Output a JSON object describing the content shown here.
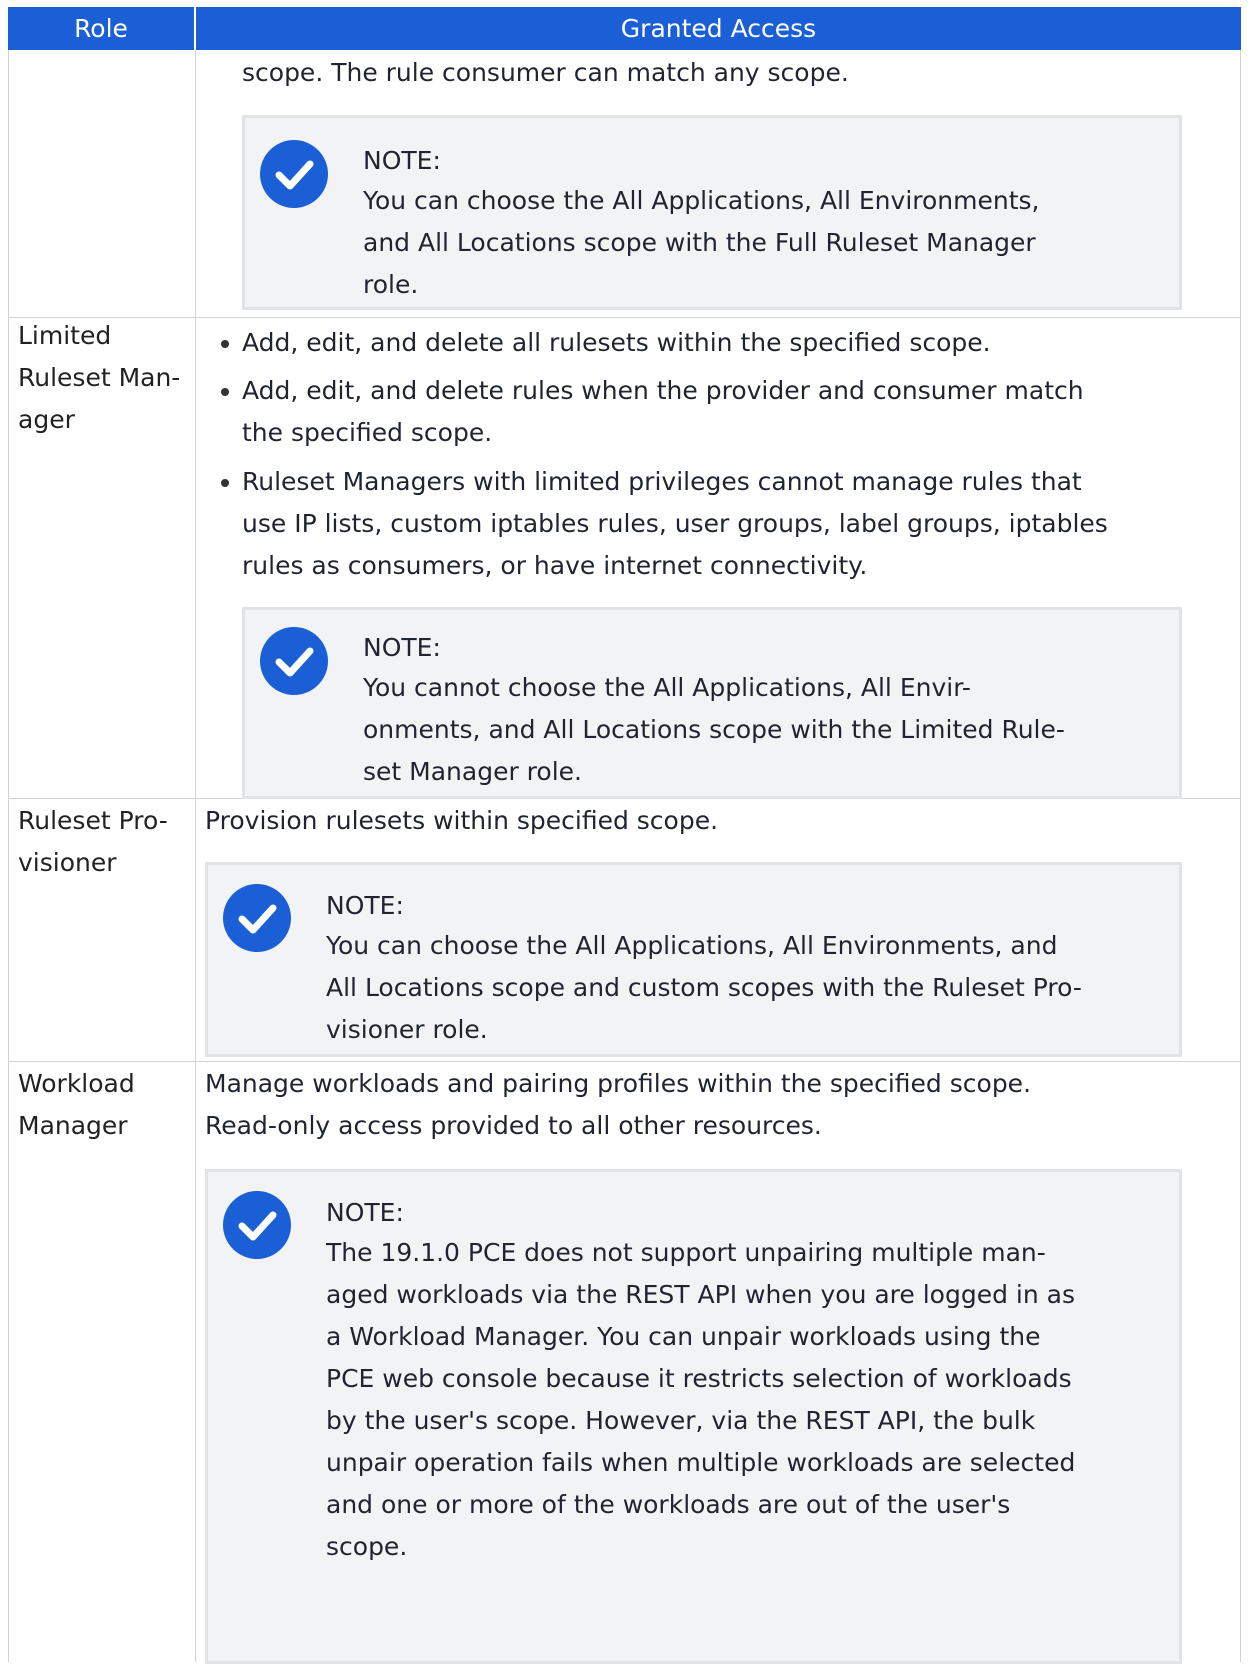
{
  "header": {
    "role": "Role",
    "granted_access": "Granted Access"
  },
  "rows": [
    {
      "role_lines": [],
      "lines": [
        "scope. The rule consumer can match any scope."
      ],
      "note": {
        "label": "NOTE:",
        "lines": [
          "You can choose the All Applications, All Environments,",
          "and All Locations scope with the Full Ruleset Manager",
          "role."
        ]
      }
    },
    {
      "role_lines": [
        "Limited",
        "Ruleset Man-",
        "ager"
      ],
      "bullets": [
        {
          "lines": [
            "Add, edit, and delete all rulesets within the specified scope."
          ]
        },
        {
          "lines": [
            "Add, edit, and delete rules when the provider and consumer match",
            "the specified scope."
          ]
        },
        {
          "lines": [
            "Ruleset Managers with limited privileges cannot manage rules that",
            "use IP lists, custom iptables rules, user groups, label groups, iptables",
            "rules as consumers, or have internet connectivity."
          ]
        }
      ],
      "note": {
        "label": "NOTE:",
        "lines": [
          "You cannot choose the All Applications, All Envir-",
          "onments, and All Locations scope with the Limited Rule-",
          "set Manager role."
        ]
      }
    },
    {
      "role_lines": [
        "Ruleset Pro-",
        "visioner"
      ],
      "lines": [
        "Provision rulesets within specified scope."
      ],
      "note": {
        "label": "NOTE:",
        "lines": [
          "You can choose the All Applications, All Environments, and",
          "All Locations scope and custom scopes with the Ruleset Pro-",
          "visioner role."
        ]
      }
    },
    {
      "role_lines": [
        "Workload",
        "Manager"
      ],
      "lines": [
        "Manage workloads and pairing profiles within the specified scope.",
        "Read-only access provided to all other resources."
      ],
      "note": {
        "label": "NOTE:",
        "lines": [
          "The 19.1.0 PCE does not support unpairing multiple man-",
          "aged workloads via the REST API when you are logged in as",
          "a Workload Manager. You can unpair workloads using the",
          "PCE web console because it restricts selection of workloads",
          "by the user's scope. However, via the REST API, the bulk",
          "unpair operation fails when multiple workloads are selected",
          "and one or more of the workloads are out of the user's",
          "scope."
        ]
      }
    }
  ],
  "colors": {
    "header_bg": "#1b5fd6",
    "note_icon": "#1b5fd6",
    "note_bg": "#f2f3f5"
  },
  "icons": {
    "note": "check-circle-icon"
  }
}
